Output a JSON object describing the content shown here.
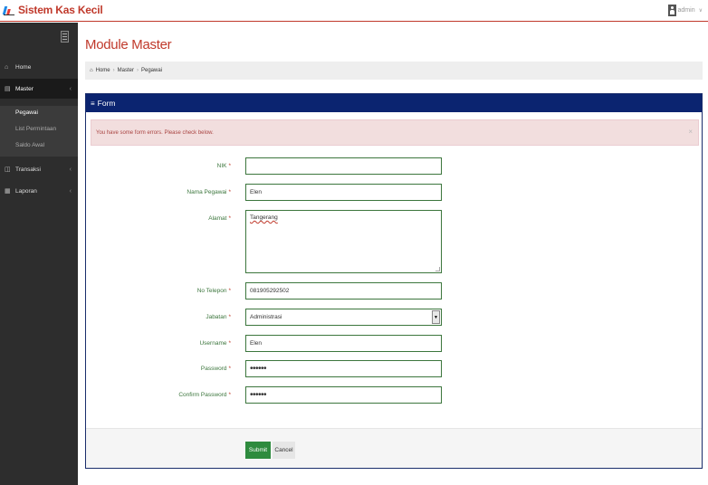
{
  "app": {
    "title": "Sistem Kas Kecil",
    "user": "admin",
    "accent": "#c0392b",
    "panel_color": "#0b2470"
  },
  "sidebar": {
    "items": [
      {
        "label": "Home",
        "icon": "home-icon"
      },
      {
        "label": "Master",
        "icon": "master-icon"
      },
      {
        "label": "Transaksi",
        "icon": "transaksi-icon"
      },
      {
        "label": "Laporan",
        "icon": "laporan-icon"
      }
    ],
    "sub": [
      "Pegawai",
      "List Permintaan",
      "Saldo Awal"
    ]
  },
  "page": {
    "title": "Module Master",
    "breadcrumb": [
      "Home",
      "Master",
      "Pegawai"
    ]
  },
  "form": {
    "heading": "Form",
    "alert": "You have some form errors. Please check below.",
    "required_mark": "*",
    "fields": {
      "nik": {
        "label": "NIK",
        "value": ""
      },
      "nama": {
        "label": "Nama Pegawai",
        "value": "Elen"
      },
      "alamat": {
        "label": "Alamat",
        "value": "Tangerang"
      },
      "telepon": {
        "label": "No Telepon",
        "value": "081905292502"
      },
      "jabatan": {
        "label": "Jabatan",
        "value": "Administrasi"
      },
      "username": {
        "label": "Username",
        "value": "Elen"
      },
      "password": {
        "label": "Password",
        "value": "••••••"
      },
      "confirm": {
        "label": "Confirm Password",
        "value": "••••••"
      }
    },
    "submit": "Submit",
    "cancel": "Cancel"
  }
}
